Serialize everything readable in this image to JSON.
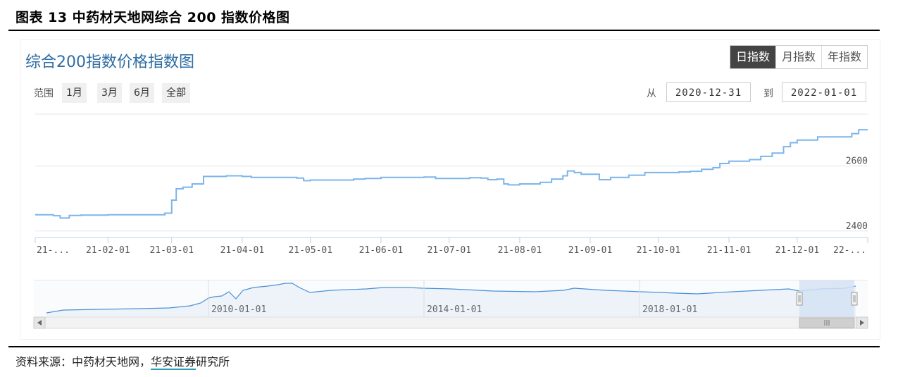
{
  "figure_title": "图表 13  中药材天地网综合 200 指数价格图",
  "chart_title": "综合200指数价格指数图",
  "period_buttons": [
    "日指数",
    "月指数",
    "年指数"
  ],
  "range": {
    "label": "范围",
    "buttons": [
      "1月",
      "3月",
      "6月",
      "全部"
    ],
    "from_label": "从",
    "from_value": "2020-12-31",
    "to_label": "到",
    "to_value": "2022-01-01"
  },
  "source": {
    "prefix": "资料来源：中药材天地网，",
    "underlined": "华安证券",
    "suffix": "研究所"
  },
  "colors": {
    "line": "#7cb5ec",
    "title": "#2e6da4",
    "active_button": "#444444",
    "navigator_mask": "#d4e2f4"
  },
  "chart_data": {
    "type": "line",
    "x_tick_labels": [
      "21-...",
      "21-02-01",
      "21-03-01",
      "21-04-01",
      "21-05-01",
      "21-06-01",
      "21-07-01",
      "21-08-01",
      "21-09-01",
      "21-10-01",
      "21-11-01",
      "21-12-01",
      "22-..."
    ],
    "y_tick_labels": [
      "2400",
      "2600"
    ],
    "ylim": [
      2380,
      2760
    ],
    "grid": true,
    "series": [
      {
        "x": [
          "2020-12-31",
          "2021-01-05",
          "2021-01-08",
          "2021-01-11",
          "2021-01-15",
          "2021-01-20",
          "2021-02-01",
          "2021-02-15",
          "2021-02-26",
          "2021-03-01",
          "2021-03-03",
          "2021-03-06",
          "2021-03-10",
          "2021-03-15",
          "2021-03-20",
          "2021-03-25",
          "2021-04-01",
          "2021-04-05",
          "2021-04-15",
          "2021-04-25",
          "2021-04-28",
          "2021-05-01",
          "2021-05-10",
          "2021-05-20",
          "2021-05-25",
          "2021-06-01",
          "2021-06-10",
          "2021-06-20",
          "2021-06-25",
          "2021-07-01",
          "2021-07-10",
          "2021-07-15",
          "2021-07-18",
          "2021-07-22",
          "2021-07-25",
          "2021-07-27",
          "2021-08-01",
          "2021-08-10",
          "2021-08-15",
          "2021-08-20",
          "2021-08-22",
          "2021-08-25",
          "2021-08-28",
          "2021-09-01",
          "2021-09-05",
          "2021-09-10",
          "2021-09-18",
          "2021-09-25",
          "2021-10-01",
          "2021-10-10",
          "2021-10-15",
          "2021-10-20",
          "2021-10-25",
          "2021-10-28",
          "2021-11-01",
          "2021-11-10",
          "2021-11-15",
          "2021-11-20",
          "2021-11-25",
          "2021-11-28",
          "2021-12-01",
          "2021-12-05",
          "2021-12-10",
          "2021-12-15",
          "2021-12-20",
          "2021-12-25",
          "2021-12-28",
          "2022-01-01"
        ],
        "y": [
          2450,
          2450,
          2447,
          2440,
          2448,
          2449,
          2450,
          2450,
          2455,
          2495,
          2530,
          2535,
          2545,
          2568,
          2568,
          2570,
          2568,
          2565,
          2565,
          2563,
          2555,
          2557,
          2557,
          2560,
          2562,
          2565,
          2565,
          2566,
          2562,
          2562,
          2564,
          2563,
          2558,
          2560,
          2545,
          2542,
          2545,
          2550,
          2560,
          2570,
          2585,
          2580,
          2575,
          2575,
          2558,
          2565,
          2572,
          2580,
          2580,
          2582,
          2584,
          2590,
          2595,
          2608,
          2615,
          2620,
          2630,
          2640,
          2660,
          2672,
          2680,
          2680,
          2690,
          2690,
          2690,
          2700,
          2712,
          2712
        ]
      }
    ],
    "navigator": {
      "x_tick_labels": [
        "2010-01-01",
        "2014-01-01",
        "2018-01-01"
      ]
    }
  }
}
